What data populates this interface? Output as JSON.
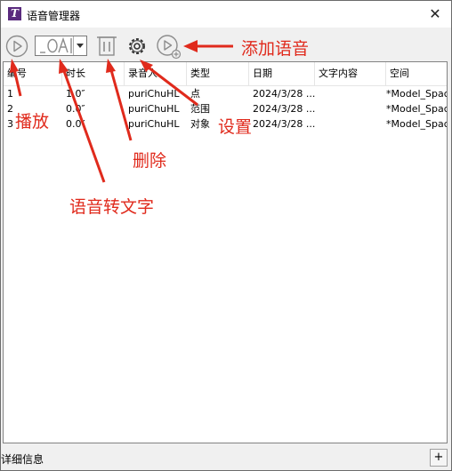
{
  "window": {
    "title": "语音管理器",
    "close_glyph": "✕",
    "app_icon_letter": "T"
  },
  "toolbar": {
    "play_icon": "play-icon",
    "speech_to_text_icon": "speech-to-text-icon",
    "voice_select_value": "",
    "delete_icon": "trash-icon",
    "settings_icon": "gear-icon",
    "add_voice_icon": "add-voice-icon"
  },
  "table": {
    "columns": [
      "编号",
      "时长",
      "录音人",
      "类型",
      "日期",
      "文字内容",
      "空间"
    ],
    "rows": [
      [
        "1",
        "1.0″",
        "puriChuHL",
        "点",
        "2024/3/28 ...",
        "",
        "*Model_Space"
      ],
      [
        "2",
        "0.0″",
        "puriChuHL",
        "范围",
        "2024/3/28 ...",
        "",
        "*Model_Space"
      ],
      [
        "3",
        "0.0″",
        "puriChuHL",
        "对象",
        "2024/3/28 ...",
        "",
        "*Model_Space"
      ]
    ]
  },
  "statusbar": {
    "label": "详细信息",
    "expand_label": "+"
  },
  "annotations": {
    "play": "播放",
    "speech_to_text": "语音转文字",
    "delete": "删除",
    "settings": "设置",
    "add_voice": "添加语音",
    "color": "#e02a1c"
  }
}
